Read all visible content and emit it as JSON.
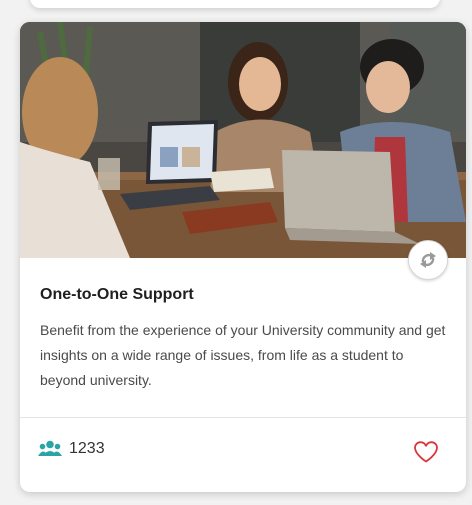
{
  "card": {
    "image_alt": "Students talking around a table with laptops",
    "title": "One-to-One Support",
    "description": "Benefit from the experience of your University community and get insights on a wide range of issues, from life as a student to beyond university.",
    "member_count": "1233",
    "icons": {
      "share": "share-icon",
      "members": "people-icon",
      "like": "heart-outline-icon"
    }
  },
  "colors": {
    "accent_teal": "#2aa4a4",
    "heart_red": "#d9363e"
  }
}
